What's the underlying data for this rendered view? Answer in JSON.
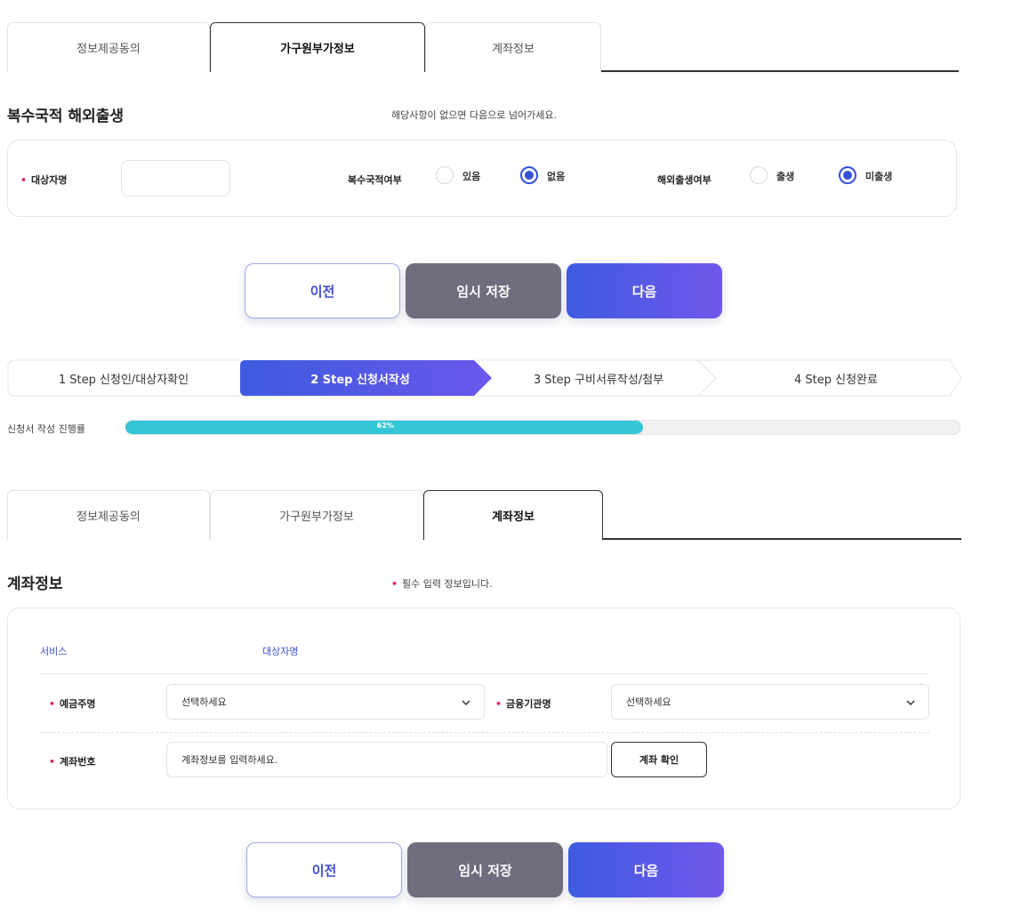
{
  "tabs_top": {
    "items": [
      {
        "label": "정보제공동의",
        "active": false
      },
      {
        "label": "가구원부가정보",
        "active": true
      },
      {
        "label": "계좌정보",
        "active": false
      }
    ]
  },
  "section_multi": {
    "title": "복수국적 해외출생",
    "note": "해당사항이 없으면 다음으로 넘어가세요.",
    "target_name_label": "대상자명",
    "target_name_value": "",
    "multi_nationality_label": "복수국적여부",
    "multi_nationality_options": [
      {
        "label": "있음",
        "selected": false
      },
      {
        "label": "없음",
        "selected": true
      }
    ],
    "overseas_birth_label": "해외출생여부",
    "overseas_birth_options": [
      {
        "label": "출생",
        "selected": false
      },
      {
        "label": "미출생",
        "selected": true
      }
    ]
  },
  "buttons_top": {
    "prev": "이전",
    "temp_save": "임시 저장",
    "next": "다음"
  },
  "stepper": {
    "steps": [
      {
        "label": "1 Step 신청인/대상자확인",
        "active": false
      },
      {
        "label": "2 Step 신청서작성",
        "active": true
      },
      {
        "label": "3 Step 구비서류작성/첨부",
        "active": false
      },
      {
        "label": "4 Step 신청완료",
        "active": false
      }
    ]
  },
  "progress": {
    "label": "신청서 작성 진행률",
    "value_text": "62%",
    "value": 0.62
  },
  "tabs_bottom": {
    "items": [
      {
        "label": "정보제공동의",
        "active": false
      },
      {
        "label": "가구원부가정보",
        "active": false
      },
      {
        "label": "계좌정보",
        "active": true
      }
    ]
  },
  "section_account": {
    "title": "계좌정보",
    "note": "필수 입력 정보입니다.",
    "col_service": "서비스",
    "col_target": "대상자명",
    "depositor_label": "예금주명",
    "depositor_placeholder": "선택하세요",
    "bank_label": "금융기관명",
    "bank_placeholder": "선택하세요",
    "account_no_label": "계좌번호",
    "account_no_placeholder": "계좌정보를 입력하세요.",
    "confirm_button": "계좌 확인"
  },
  "buttons_bottom": {
    "prev": "이전",
    "temp_save": "임시 저장",
    "next": "다음"
  },
  "colors": {
    "accent": "#3450d6",
    "progress": "#34c6d6",
    "required": "#e0245e",
    "temp_button": "#6e6e7e"
  },
  "icons": [
    "chevron-down-icon",
    "required-dot-icon",
    "step-arrow-icon"
  ]
}
